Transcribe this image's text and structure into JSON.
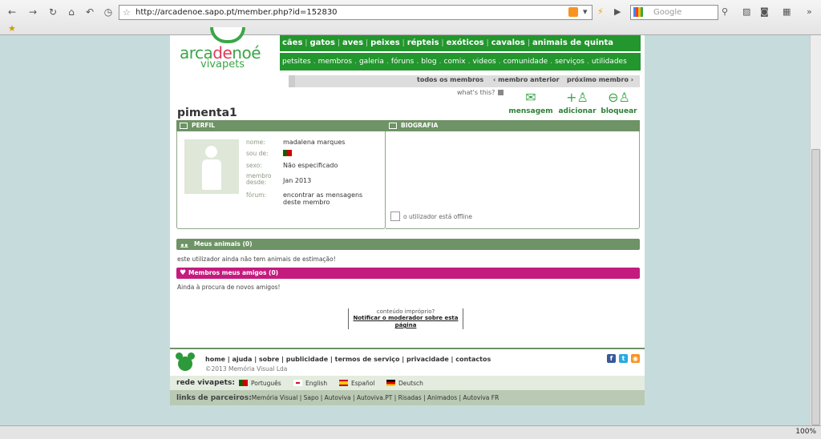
{
  "browser": {
    "url": "http://arcadenoe.sapo.pt/member.php?id=152830",
    "search_placeholder": "Google",
    "zoom": "100%"
  },
  "site": {
    "logo_main_a": "arca",
    "logo_main_b": "de",
    "logo_main_c": "noé",
    "logo_sub": "vivapets",
    "nav_primary": [
      "cães",
      "gatos",
      "aves",
      "peixes",
      "répteis",
      "exóticos",
      "cavalos",
      "animais de quinta"
    ],
    "nav_secondary": [
      "petsites",
      "membros",
      "galeria",
      "fóruns",
      "blog",
      "comix",
      "videos",
      "comunidade",
      "serviços",
      "utilidades"
    ],
    "subnav": {
      "all": "todos os membros",
      "prev": "‹ membro anterior",
      "next": "próximo membro ›"
    },
    "whats_this": "what's this?"
  },
  "profile": {
    "username": "pimenta1",
    "actions": [
      {
        "label": "mensagem",
        "icon": "envelope-icon",
        "glyph": "✉"
      },
      {
        "label": "adicionar",
        "icon": "add-user-icon",
        "glyph": "+♙"
      },
      {
        "label": "bloquear",
        "icon": "block-user-icon",
        "glyph": "⊖♙"
      }
    ],
    "perfil_title": "PERFIL",
    "bio_title": "BIOGRAFIA",
    "fields": {
      "nome_label": "nome:",
      "nome_value": "madalena marques",
      "sou_label": "sou de:",
      "sexo_label": "sexo:",
      "sexo_value": "Não especificado",
      "membro_label": "membro desde:",
      "membro_value": "Jan 2013",
      "forum_label": "fórum:",
      "forum_link": "encontrar as mensagens deste membro"
    },
    "offline_status": "o utilizador está offline"
  },
  "sections": {
    "animals_title": "Meus animais (0)",
    "animals_text": "este utilizador ainda não tem animais de estimação!",
    "friends_title": "Membros meus amigos (0)",
    "friends_text": "Ainda à procura de novos amigos!"
  },
  "report": {
    "question": "conteúdo impróprio?",
    "link": "Notificar o moderador sobre esta página"
  },
  "footer": {
    "links": "home | ajuda | sobre | publicidade | termos de serviço | privacidade | contactos",
    "copyright": "©2013 Memória Visual Lda",
    "rede_label": "rede vivapets:",
    "languages": [
      "Português",
      "English",
      "Español",
      "Deutsch"
    ],
    "partners_label": "links de parceiros:",
    "partners": "Memória Visual | Sapo | Autoviva | Autoviva.PT | Risadas | Animados | Autoviva FR"
  },
  "colors": {
    "brand_green": "#23962e",
    "panel_green": "#6e9366",
    "friends_magenta": "#c41b7f"
  }
}
